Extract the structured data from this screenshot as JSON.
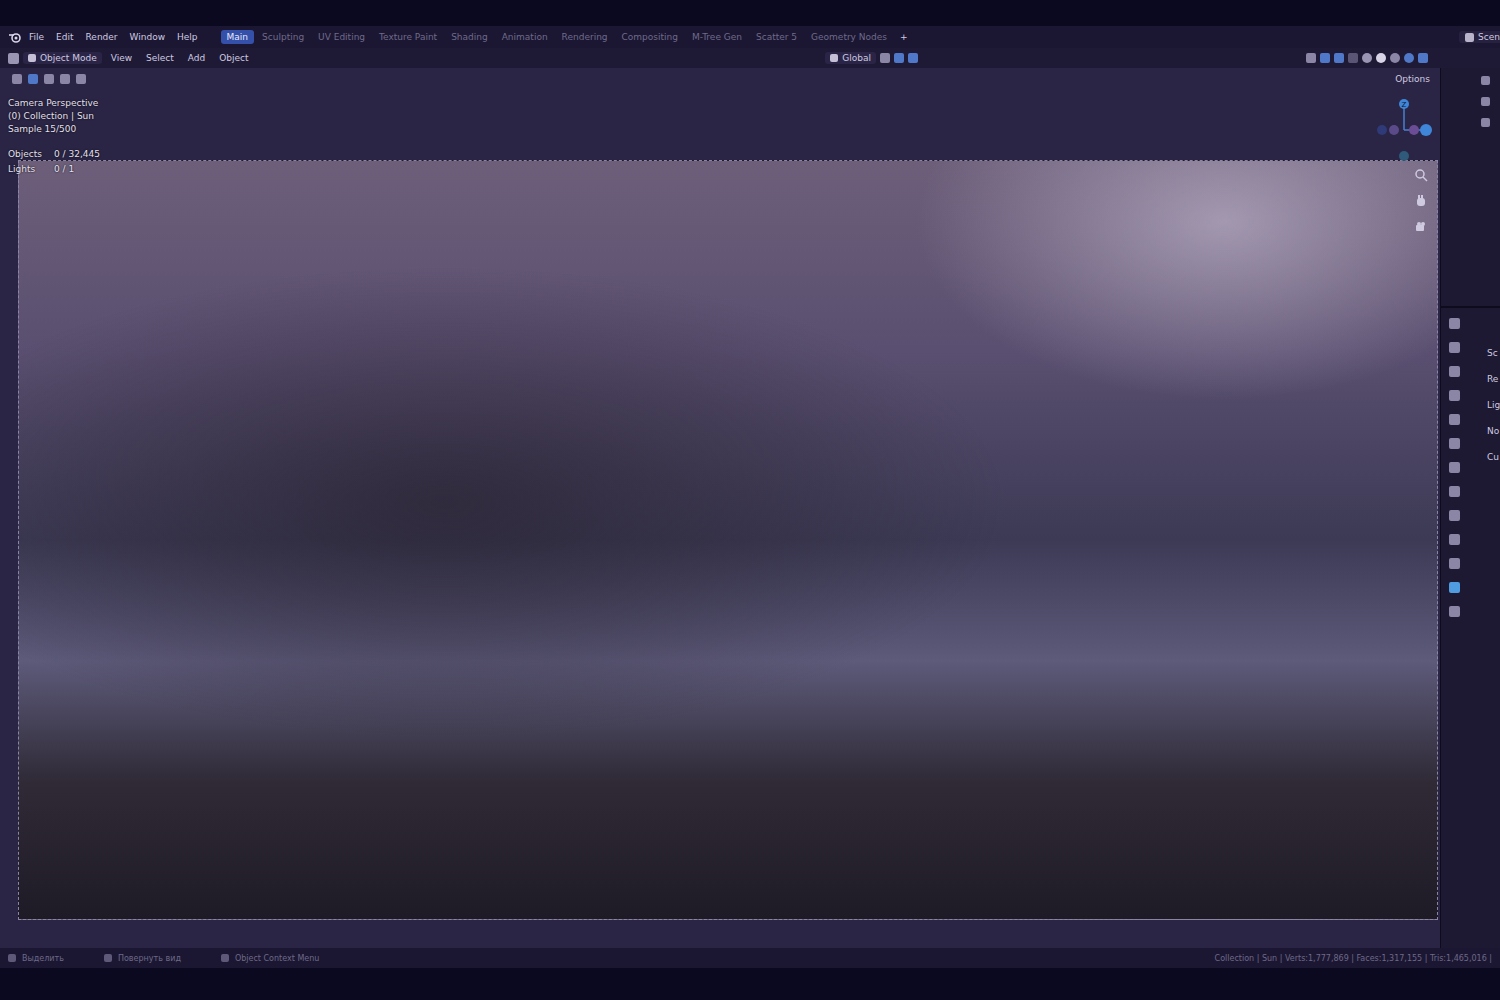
{
  "window": {
    "title": "Blender",
    "scene_field": "Scen"
  },
  "menu": [
    "File",
    "Edit",
    "Render",
    "Window",
    "Help"
  ],
  "workspaces": [
    {
      "label": "Main",
      "selected": true
    },
    {
      "label": "Sculpting",
      "selected": false
    },
    {
      "label": "UV Editing",
      "selected": false
    },
    {
      "label": "Texture Paint",
      "selected": false
    },
    {
      "label": "Shading",
      "selected": false
    },
    {
      "label": "Animation",
      "selected": false
    },
    {
      "label": "Rendering",
      "selected": false
    },
    {
      "label": "Compositing",
      "selected": false
    },
    {
      "label": "M-Tree Gen",
      "selected": false
    },
    {
      "label": "Scatter 5",
      "selected": false
    },
    {
      "label": "Geometry Nodes",
      "selected": false
    }
  ],
  "add_workspace": "+",
  "header": {
    "mode": "Object Mode",
    "menus": [
      "View",
      "Select",
      "Add",
      "Object"
    ],
    "orientation": "Global"
  },
  "viewport": {
    "overlay": [
      "Camera Perspective",
      "(0) Collection | Sun",
      "Sample 15/500"
    ],
    "stats": [
      {
        "label": "Objects",
        "value": "0 / 32,445"
      },
      {
        "label": "Lights",
        "value": "0 / 1"
      }
    ],
    "options": "Options",
    "gizmo_label": "Z"
  },
  "properties_labels": [
    "Sc",
    "Re",
    "Lig",
    "No",
    "Cu"
  ],
  "status_bar": {
    "items": [
      "Выделить",
      "Повернуть вид",
      "Object Context Menu"
    ],
    "info": "Collection | Sun | Verts:1,777,869 | Faces:1,317,155 | Tris:1,465,016 |"
  }
}
